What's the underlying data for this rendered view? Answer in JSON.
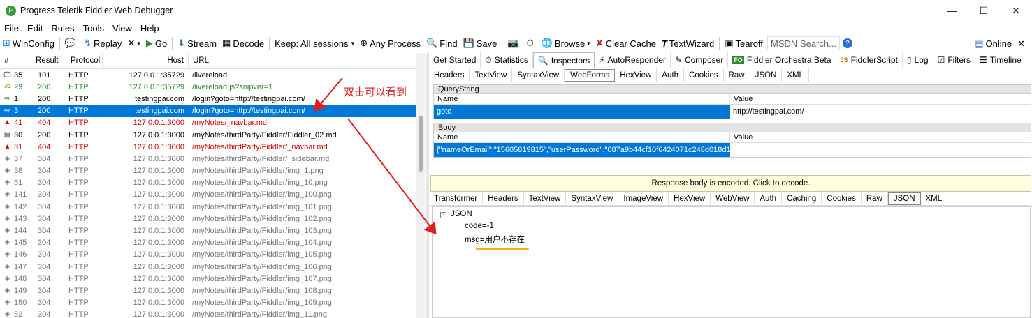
{
  "window": {
    "title": "Progress Telerik Fiddler Web Debugger",
    "app_icon": "F"
  },
  "menu": [
    "File",
    "Edit",
    "Rules",
    "Tools",
    "View",
    "Help"
  ],
  "toolbar": {
    "winconfig": "WinConfig",
    "replay": "Replay",
    "go": "Go",
    "stream": "Stream",
    "decode": "Decode",
    "keep": "Keep: All sessions",
    "any_process": "Any Process",
    "find": "Find",
    "save": "Save",
    "browse": "Browse",
    "clear_cache": "Clear Cache",
    "text_wizard": "TextWizard",
    "tearoff": "Tearoff",
    "msdn_placeholder": "MSDN Search...",
    "online": "Online"
  },
  "sessions": {
    "headers": [
      "#",
      "Result",
      "Protocol",
      "Host",
      "URL"
    ],
    "rows": [
      {
        "num": "35",
        "result": "101",
        "protocol": "HTTP",
        "host": "127.0.0.1:35729",
        "url": "/livereload",
        "style": "normal",
        "icon": "monitor-icon"
      },
      {
        "num": "29",
        "result": "200",
        "protocol": "HTTP",
        "host": "127.0.0.1:35729",
        "url": "/livereload.js?snipver=1",
        "style": "green",
        "icon": "js-icon"
      },
      {
        "num": "1",
        "result": "200",
        "protocol": "HTTP",
        "host": "testingpai.com",
        "url": "/login?goto=http://testingpai.com/",
        "style": "normal",
        "icon": "arrow-icon"
      },
      {
        "num": "3",
        "result": "200",
        "protocol": "HTTP",
        "host": "testingpai.com",
        "url": "/login?goto=http://testingpai.com/",
        "style": "sel",
        "icon": "arrow-icon"
      },
      {
        "num": "41",
        "result": "404",
        "protocol": "HTTP",
        "host": "127.0.0.1:3000",
        "url": "/myNotes/_navbar.md",
        "style": "err",
        "icon": "warning-icon"
      },
      {
        "num": "30",
        "result": "200",
        "protocol": "HTTP",
        "host": "127.0.0.1:3000",
        "url": "/myNotes/thirdParty/Fiddler/Fiddler_02.md",
        "style": "normal",
        "icon": "document-icon"
      },
      {
        "num": "31",
        "result": "404",
        "protocol": "HTTP",
        "host": "127.0.0.1:3000",
        "url": "/myNotes/thirdParty/Fiddler/_navbar.md",
        "style": "err",
        "icon": "warning-icon"
      },
      {
        "num": "37",
        "result": "304",
        "protocol": "HTTP",
        "host": "127.0.0.1:3000",
        "url": "/myNotes/thirdParty/Fiddler/_sidebar.md",
        "style": "grey",
        "icon": "diamond-icon"
      },
      {
        "num": "38",
        "result": "304",
        "protocol": "HTTP",
        "host": "127.0.0.1:3000",
        "url": "/myNotes/thirdParty/Fiddler/img_1.png",
        "style": "grey",
        "icon": "diamond-icon"
      },
      {
        "num": "51",
        "result": "304",
        "protocol": "HTTP",
        "host": "127.0.0.1:3000",
        "url": "/myNotes/thirdParty/Fiddler/img_10.png",
        "style": "grey",
        "icon": "diamond-icon"
      },
      {
        "num": "141",
        "result": "304",
        "protocol": "HTTP",
        "host": "127.0.0.1:3000",
        "url": "/myNotes/thirdParty/Fiddler/img_100.png",
        "style": "grey",
        "icon": "diamond-icon"
      },
      {
        "num": "142",
        "result": "304",
        "protocol": "HTTP",
        "host": "127.0.0.1:3000",
        "url": "/myNotes/thirdParty/Fiddler/img_101.png",
        "style": "grey",
        "icon": "diamond-icon"
      },
      {
        "num": "143",
        "result": "304",
        "protocol": "HTTP",
        "host": "127.0.0.1:3000",
        "url": "/myNotes/thirdParty/Fiddler/img_102.png",
        "style": "grey",
        "icon": "diamond-icon"
      },
      {
        "num": "144",
        "result": "304",
        "protocol": "HTTP",
        "host": "127.0.0.1:3000",
        "url": "/myNotes/thirdParty/Fiddler/img_103.png",
        "style": "grey",
        "icon": "diamond-icon"
      },
      {
        "num": "145",
        "result": "304",
        "protocol": "HTTP",
        "host": "127.0.0.1:3000",
        "url": "/myNotes/thirdParty/Fiddler/img_104.png",
        "style": "grey",
        "icon": "diamond-icon"
      },
      {
        "num": "146",
        "result": "304",
        "protocol": "HTTP",
        "host": "127.0.0.1:3000",
        "url": "/myNotes/thirdParty/Fiddler/img_105.png",
        "style": "grey",
        "icon": "diamond-icon"
      },
      {
        "num": "147",
        "result": "304",
        "protocol": "HTTP",
        "host": "127.0.0.1:3000",
        "url": "/myNotes/thirdParty/Fiddler/img_106.png",
        "style": "grey",
        "icon": "diamond-icon"
      },
      {
        "num": "148",
        "result": "304",
        "protocol": "HTTP",
        "host": "127.0.0.1:3000",
        "url": "/myNotes/thirdParty/Fiddler/img_107.png",
        "style": "grey",
        "icon": "diamond-icon"
      },
      {
        "num": "149",
        "result": "304",
        "protocol": "HTTP",
        "host": "127.0.0.1:3000",
        "url": "/myNotes/thirdParty/Fiddler/img_108.png",
        "style": "grey",
        "icon": "diamond-icon"
      },
      {
        "num": "150",
        "result": "304",
        "protocol": "HTTP",
        "host": "127.0.0.1:3000",
        "url": "/myNotes/thirdParty/Fiddler/img_109.png",
        "style": "grey",
        "icon": "diamond-icon"
      },
      {
        "num": "52",
        "result": "304",
        "protocol": "HTTP",
        "host": "127.0.0.1:3000",
        "url": "/myNotes/thirdParty/Fiddler/img_11.png",
        "style": "grey",
        "icon": "diamond-icon"
      }
    ]
  },
  "annotation": {
    "text": "双击可以看到",
    "color": "#e02020"
  },
  "inspector_tabs": [
    {
      "label": "Get Started",
      "icon": ""
    },
    {
      "label": "Statistics",
      "icon": "⏱"
    },
    {
      "label": "Inspectors",
      "icon": "🔍"
    },
    {
      "label": "AutoResponder",
      "icon": "⚡"
    },
    {
      "label": "Composer",
      "icon": "✎"
    },
    {
      "label": "Fiddler Orchestra Beta",
      "icon": "FO"
    },
    {
      "label": "FiddlerScript",
      "icon": "JS"
    },
    {
      "label": "Log",
      "icon": "▯"
    },
    {
      "label": "Filters",
      "icon": "☑"
    },
    {
      "label": "Timeline",
      "icon": "☰"
    }
  ],
  "request_tabs": [
    "Headers",
    "TextView",
    "SyntaxView",
    "WebForms",
    "HexView",
    "Auth",
    "Cookies",
    "Raw",
    "JSON",
    "XML"
  ],
  "request_tabs_active": "WebForms",
  "querystring": {
    "section": "QueryString",
    "col_name": "Name",
    "col_value": "Value",
    "name": "goto",
    "value": "http://testingpai.com/"
  },
  "body": {
    "section": "Body",
    "col_name": "Name",
    "col_value": "Value",
    "name": "{\"nameOrEmail\":\"15605819815\",\"userPassword\":\"087a9b44cf10f6424071c248d018d1b",
    "value": ""
  },
  "response_banner": "Response body is encoded. Click to decode.",
  "response_tabs": [
    "Transformer",
    "Headers",
    "TextView",
    "SyntaxView",
    "ImageView",
    "HexView",
    "WebView",
    "Auth",
    "Caching",
    "Cookies",
    "Raw",
    "JSON",
    "XML"
  ],
  "response_tabs_active": "JSON",
  "json_tree": {
    "root": "JSON",
    "expander": "−",
    "children": [
      "code=-1",
      "msg=用户不存在"
    ]
  },
  "colors": {
    "selection": "#0078d7",
    "error": "#e00000",
    "success_green": "#2a8a2a",
    "highlight_underline": "#f5b800"
  }
}
